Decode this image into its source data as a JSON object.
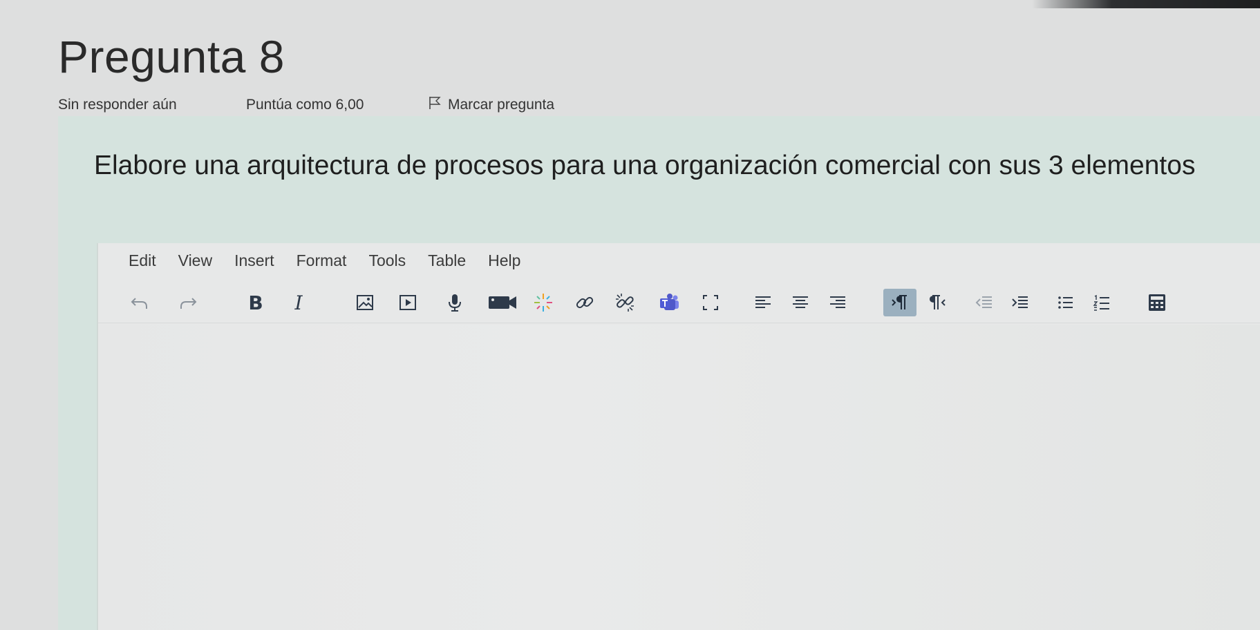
{
  "question": {
    "title": "Pregunta 8",
    "status": "Sin responder aún",
    "score": "Puntúa como 6,00",
    "flag_label": "Marcar pregunta",
    "text": "Elabore una arquitectura de procesos para una organización comercial con sus 3 elementos"
  },
  "editor": {
    "menu": [
      "Edit",
      "View",
      "Insert",
      "Format",
      "Tools",
      "Table",
      "Help"
    ],
    "toolbar_icons": [
      "undo-icon",
      "redo-icon",
      "bold-icon",
      "italic-icon",
      "image-icon",
      "media-icon",
      "microphone-icon",
      "video-camera-icon",
      "spark-icon",
      "link-icon",
      "unlink-icon",
      "teams-icon",
      "fullscreen-icon",
      "align-left-icon",
      "align-center-icon",
      "align-right-icon",
      "ltr-icon",
      "rtl-icon",
      "outdent-icon",
      "indent-icon",
      "bullet-list-icon",
      "numbered-list-icon",
      "calculator-icon"
    ],
    "active_button": "ltr-icon",
    "content": ""
  },
  "colors": {
    "background": "#dedfdf",
    "question_box": "#d5e3de",
    "editor": "#e7e8e8",
    "active_button": "#9bb0bf",
    "teams": "#4f5bd5"
  }
}
